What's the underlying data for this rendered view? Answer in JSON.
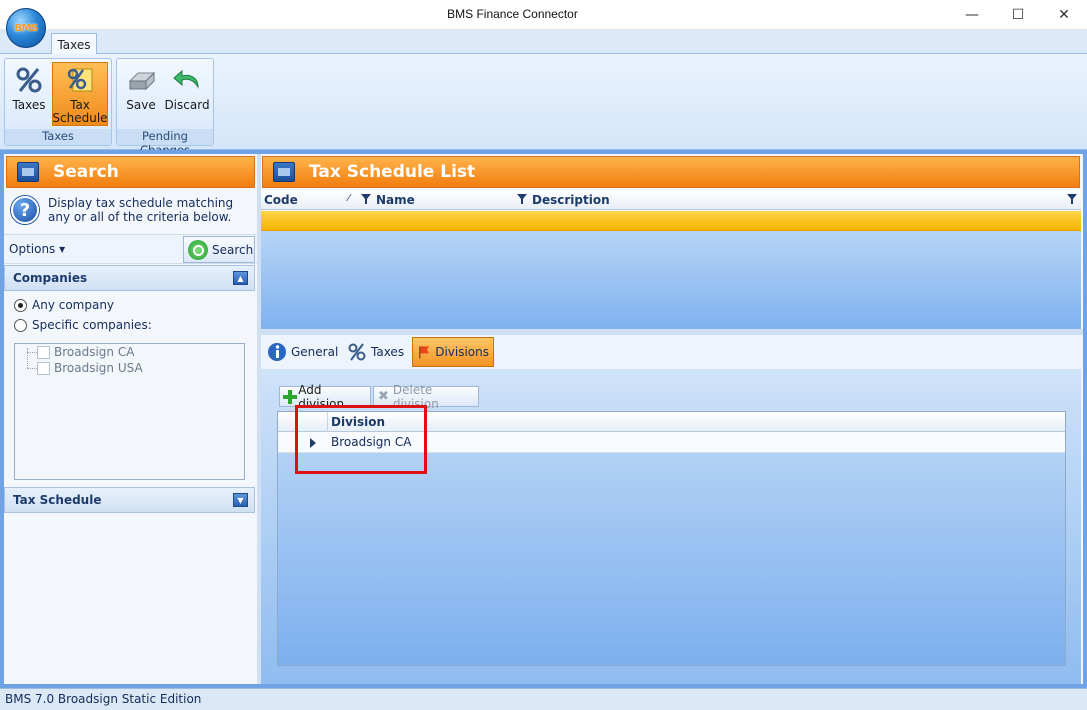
{
  "window": {
    "title": "BMS Finance Connector",
    "logo_text": "BMS",
    "minimize": "—",
    "maximize": "☐",
    "close": "✕"
  },
  "ribbon": {
    "tab": "Taxes",
    "groups": [
      {
        "label": "Taxes",
        "buttons": [
          {
            "label": "Taxes",
            "icon": "percent-icon"
          },
          {
            "label_line1": "Tax",
            "label_line2": "Schedule",
            "icon": "tax-schedule-icon",
            "active": true
          }
        ]
      },
      {
        "label": "Pending Changes",
        "buttons": [
          {
            "label": "Save",
            "icon": "save-icon"
          },
          {
            "label": "Discard",
            "icon": "undo-icon"
          }
        ]
      }
    ]
  },
  "search_panel": {
    "title": "Search",
    "help_text": "Display tax schedule matching any or all of the criteria below.",
    "options_label": "Options ▾",
    "search_button": "Search",
    "companies_section": "Companies",
    "radio_any": "Any company",
    "radio_specific": "Specific companies:",
    "companies": [
      "Broadsign CA",
      "Broadsign USA"
    ],
    "tax_schedule_section": "Tax Schedule"
  },
  "list_panel": {
    "title": "Tax Schedule List",
    "columns": [
      "Code",
      "Name",
      "Description"
    ]
  },
  "detail": {
    "tabs": [
      "General",
      "Taxes",
      "Divisions"
    ],
    "active_tab": "Divisions",
    "add_button": "Add division",
    "delete_button": "Delete division",
    "grid_header": "Division",
    "rows": [
      "Broadsign CA"
    ]
  },
  "status_bar": "BMS 7.0 Broadsign Static Edition",
  "colors": {
    "accent_orange": "#f27d10",
    "selection_yellow": "#f5b400",
    "frame_blue": "#6fa3e6",
    "highlight_red": "#e01010"
  }
}
